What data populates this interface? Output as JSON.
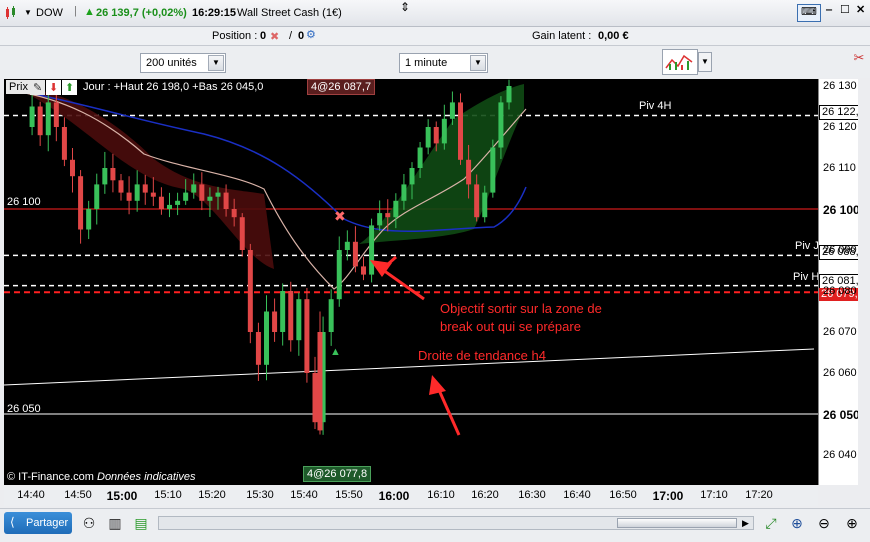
{
  "titlebar": {
    "symbol": "DOW",
    "price_change": "26 139,7 (+0,02%)",
    "time": "16:29:15",
    "instrument": "Wall Street Cash (1€)"
  },
  "infobar": {
    "position_label": "Position :",
    "position_value": "0",
    "position_sep": "/",
    "position_value2": "0",
    "gain_label": "Gain latent :",
    "gain_value": "0,00 €"
  },
  "toolbar": {
    "units_value": "200 unités",
    "timeframe_value": "1 minute"
  },
  "chart_header": {
    "prix_label": "Prix",
    "ohlc_text": "Jour : +Haut 26 198,0 +Bas 26 045,0",
    "top_tag": "4@26 087,7",
    "bottom_tag": "4@26 077,8",
    "copyright": "© IT-Finance.com",
    "disclaimer": "Données indicatives"
  },
  "levels": {
    "label_26100": "26 100",
    "label_26050": "26 050",
    "piv_4h": "Piv 4H",
    "piv_j": "Piv J",
    "piv_h": "Piv H"
  },
  "annotations": {
    "objective_line1": "Objectif sortir sur la zone de",
    "objective_line2": "break out qui se prépare",
    "trendline": "Droite de tendance h4"
  },
  "yaxis": {
    "ticks": [
      "26 130",
      "26 120",
      "26 110",
      "26 100",
      "26 090",
      "26 080",
      "26 070",
      "26 060",
      "26 050",
      "26 040"
    ],
    "box_pivot4h": "26 122,8",
    "box_pivj": "26 088,7",
    "box_pivh": "26 081,3",
    "box_red": "26 079,7"
  },
  "xaxis": {
    "ticks": [
      "14:40",
      "14:50",
      "15:00",
      "15:10",
      "15:20",
      "15:30",
      "15:40",
      "15:50",
      "16:00",
      "16:10",
      "16:20",
      "16:30",
      "16:40",
      "16:50",
      "17:00",
      "17:10",
      "17:20"
    ]
  },
  "bottombar": {
    "share_label": "Partager"
  },
  "colors": {
    "bull": "#39c15a",
    "bear": "#e14747",
    "background": "#000000",
    "level_red": "#ff2020",
    "ma_blue": "#1a2fc4"
  }
}
